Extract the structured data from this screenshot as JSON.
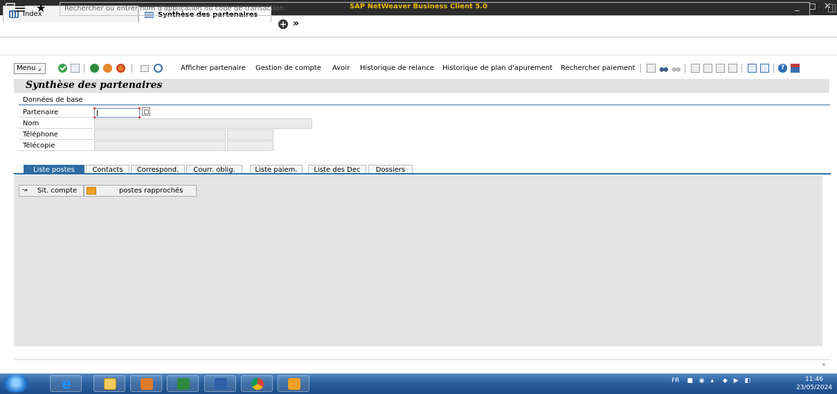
{
  "window": {
    "title": "SAP NetWeaver Business Client 5.0"
  },
  "app_tabs": [
    {
      "label": "Index",
      "icon": "index-icon"
    },
    {
      "label": "Synthèse des partenaires",
      "icon": "page-icon"
    }
  ],
  "command": {
    "search_placeholder": "Rechercher ou entrer nom d'application ou code de transaction"
  },
  "toolbar": {
    "menu_label": "Menu",
    "afficher_partenaire": "Afficher partenaire",
    "gestion_compte": "Gestion de compte",
    "avoir": "Avoir",
    "historique_relance": "Historique de relance",
    "historique_plan": "Historique de plan d'apurement",
    "rechercher_paiement": "Rechercher paiement"
  },
  "page": {
    "title": "Synthèse des partenaires"
  },
  "donnees_de_base": {
    "title": "Données de base",
    "fields": [
      {
        "label": "Partenaire",
        "value": ""
      },
      {
        "label": "Nom",
        "value": ""
      },
      {
        "label": "Téléphone",
        "value": ""
      },
      {
        "label": "Télécopie",
        "value": ""
      }
    ]
  },
  "tabs": [
    "Liste postes",
    "Contacts",
    "Correspond.",
    "Courr. oblig.",
    "Liste paiem.",
    "Liste des Dec",
    "Dossiers"
  ],
  "content_buttons": {
    "sit_compte": "Sit. compte",
    "postes_rapproches": "postes rapprochés"
  },
  "footer": {
    "collapse": "«"
  },
  "taskbar": {
    "language": "FR",
    "time": "11:46",
    "date": "23/05/2024"
  },
  "colors": {
    "title_text": "#e8b800",
    "tab_active": "#2e6da4",
    "taskbar": "#2b5f9e"
  }
}
